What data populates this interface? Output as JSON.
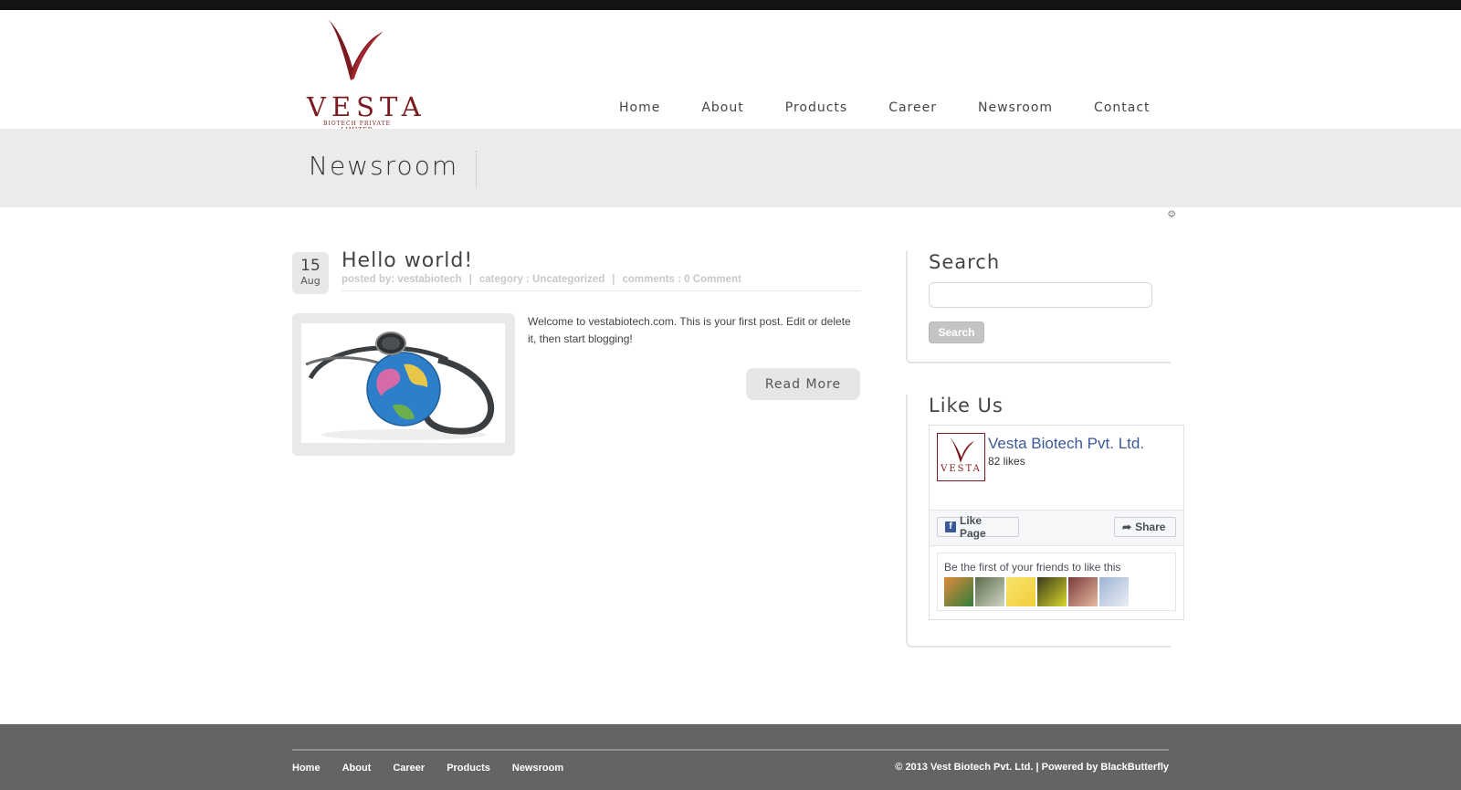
{
  "brand": {
    "name": "VESTA",
    "tagline": "BIOTECH PRIVATE LIMITED"
  },
  "nav": [
    {
      "label": "Home"
    },
    {
      "label": "About"
    },
    {
      "label": "Products"
    },
    {
      "label": "Career"
    },
    {
      "label": "Newsroom"
    },
    {
      "label": "Contact"
    }
  ],
  "page": {
    "title": "Newsroom"
  },
  "post": {
    "day": "15",
    "month": "Aug",
    "title": "Hello world!",
    "author": "posted by: vestabiotech",
    "category": "category : Uncategorized",
    "comments": "comments : 0 Comment",
    "excerpt": "Welcome to vestabiotech.com. This is your first post. Edit or delete it, then start blogging!",
    "read_more": "Read More"
  },
  "sidebar": {
    "search": {
      "title": "Search",
      "button": "Search",
      "placeholder": ""
    },
    "like": {
      "title": "Like Us",
      "page_name": "Vesta Biotech Pvt. Ltd.",
      "likes": "82 likes",
      "like_button": "Like Page",
      "share_button": "Share",
      "friends_text": "Be the first of your friends to like this"
    }
  },
  "footer": {
    "nav": [
      {
        "label": "Home"
      },
      {
        "label": "About"
      },
      {
        "label": "Career"
      },
      {
        "label": "Products"
      },
      {
        "label": "Newsroom"
      }
    ],
    "copyright": "© 2013 Vest Biotech Pvt. Ltd. | Powered by BlackButterfly"
  },
  "colors": {
    "brand": "#7b1a1f",
    "facebook": "#3b5998",
    "footer_bg": "#626466",
    "title_band": "#ebebeb"
  }
}
